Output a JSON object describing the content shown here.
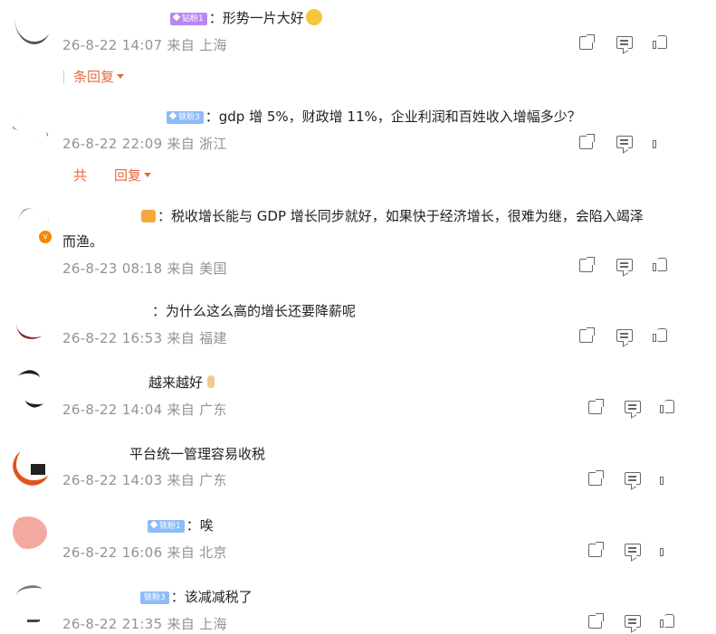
{
  "colors": {
    "accent": "#e66b3a",
    "meta": "#939393",
    "badge_purple": "#b987f5",
    "badge_blue": "#8cbcf8",
    "verify": "#f08a00"
  },
  "comments": [
    {
      "badge": "钻粉1",
      "badge_color": "purple",
      "text": "：形势一片大好",
      "emoji": "smile-emoji",
      "meta": "26-8-22 14:07 来自 上海",
      "reply_prefix": "条",
      "reply_label": "回复"
    },
    {
      "badge": "铁粉3",
      "badge_color": "blue",
      "text": "：gdp 增 5%，财政增 11%，企业利润和百姓收入增幅多少？",
      "meta": "26-8-22 22:09 来自 浙江",
      "reply_prefix": "共",
      "reply_label": "回复"
    },
    {
      "crown": true,
      "text": "：税收增长能与 GDP 增长同步就好，如果快于经济增长，很难为继，会陷入竭泽",
      "text2": "而渔。",
      "meta": "26-8-23 08:18 来自 美国"
    },
    {
      "text": "：为什么这么高的增长还要降薪呢",
      "meta": "26-8-22 16:53 来自 福建"
    },
    {
      "text": "越来越好",
      "emoji": "thumb-emoji",
      "meta": "26-8-22 14:04 来自 广东"
    },
    {
      "text": "平台统一管理容易收税",
      "meta": "26-8-22 14:03 来自 广东"
    },
    {
      "badge": "铁粉1",
      "badge_color": "blue",
      "text": "：唉",
      "meta": "26-8-22 16:06 来自 北京"
    },
    {
      "badge": "铁粉3",
      "badge_color": "blue",
      "text": "：该减减税了",
      "meta": "26-8-22 21:35 来自 上海"
    }
  ],
  "verify_mark": "v",
  "icons": {
    "share": "share-icon",
    "comment": "comment-icon",
    "like": "like-icon"
  }
}
